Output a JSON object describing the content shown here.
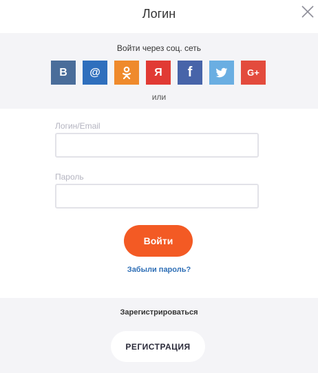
{
  "header": {
    "title": "Логин"
  },
  "social": {
    "title": "Войти через соц. сеть",
    "or_label": "или",
    "buttons": [
      {
        "name": "vk",
        "glyph": "В",
        "color": "#4a6d9a"
      },
      {
        "name": "mailru",
        "glyph": "@",
        "color": "#2f6fbd"
      },
      {
        "name": "odnoklassniki",
        "glyph": "ok",
        "color": "#ef8a2c"
      },
      {
        "name": "yandex",
        "glyph": "Я",
        "color": "#e13a34"
      },
      {
        "name": "facebook",
        "glyph": "f",
        "color": "#4764a9"
      },
      {
        "name": "twitter",
        "glyph": "tw",
        "color": "#6aaee2"
      },
      {
        "name": "googleplus",
        "glyph": "G+",
        "color": "#e34b3d"
      }
    ]
  },
  "form": {
    "login_label": "Логин/Email",
    "login_value": "",
    "password_label": "Пароль",
    "password_value": "",
    "submit_label": "Войти",
    "forgot_label": "Забыли пароль?"
  },
  "register": {
    "label": "Зарегистрироваться",
    "button_label": "РЕГИСТРАЦИЯ"
  },
  "colors": {
    "accent": "#f35a24",
    "link": "#2f6fb6",
    "panel_bg": "#f4f4f7"
  }
}
